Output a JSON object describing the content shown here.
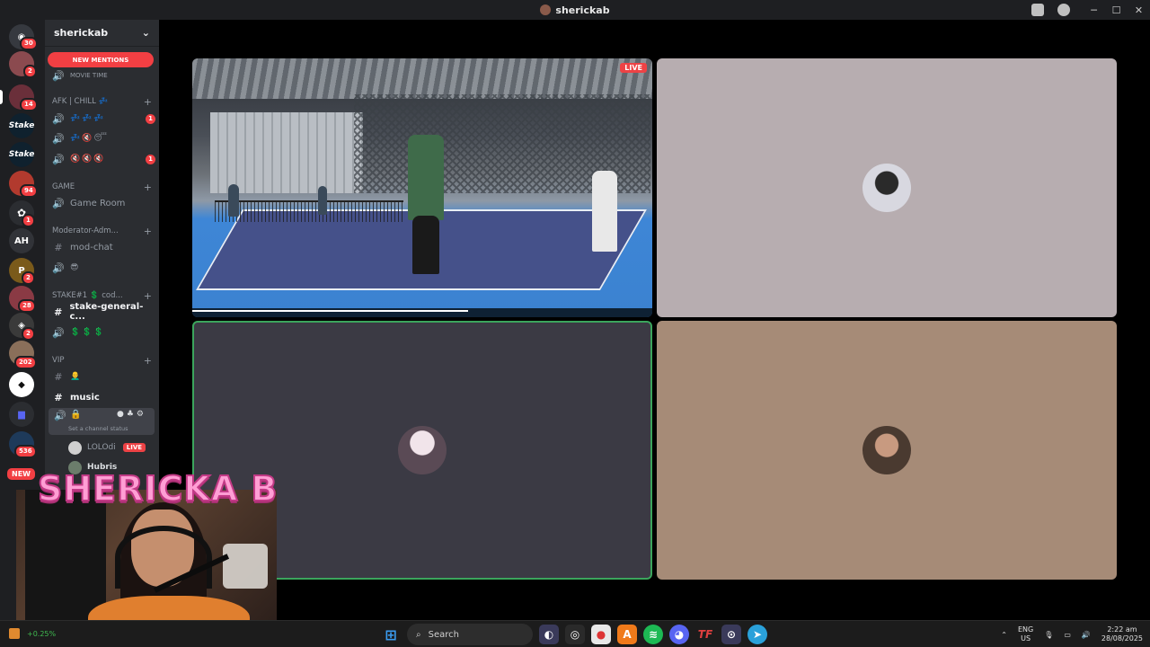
{
  "window": {
    "title": "sherickab"
  },
  "sidebar": {
    "server_name": "sherickab",
    "new_mentions": "NEW MENTIONS",
    "movie_time": "MOVIE TIME",
    "categories": {
      "afk": "AFK | CHILL 💤",
      "game": "GAME",
      "moderator": "Moderator-Adm...",
      "stake": "STAKE#1 💲 cod...",
      "vip": "VIP"
    },
    "channels": {
      "afk_1": "💤💤💤",
      "afk_2": "💤🔇😴",
      "afk_3": "🔇🔇🔇",
      "afk_1_badge": "1",
      "afk_3_badge": "1",
      "game_room": "Game Room",
      "mod_chat": "mod-chat",
      "mod_voice": "😎",
      "stake_general": "stake-general-c...",
      "stake_voice": "💲💲💲",
      "vip_text": "👨‍🦲",
      "music": "music",
      "set_status": "Set a channel status"
    },
    "voice_users": [
      {
        "name": "LOLOdi",
        "live": "LIVE"
      },
      {
        "name": "Hubris"
      }
    ]
  },
  "rail": {
    "badges": [
      "30",
      "2",
      "14",
      "94",
      "1",
      "2",
      "28",
      "2",
      "202",
      "536"
    ],
    "ah_label": "AH",
    "new_label": "NEW"
  },
  "stage": {
    "stream_live_badge": "LIVE"
  },
  "overlay": {
    "streamer_name": "SHERICKA B",
    "stat": "+0.25%"
  },
  "taskbar": {
    "search_placeholder": "Search",
    "lang_top": "ENG",
    "lang_bottom": "US",
    "time": "2:22 am",
    "date": "28/08/2025"
  },
  "colors": {
    "discord_bg": "#2b2d31",
    "rail_bg": "#1e1f22",
    "red": "#f23f43",
    "tile_gray": "#b7adb0",
    "tile_dark": "#3b3a44",
    "tile_tan": "#a68b77",
    "speaking_green": "#3ba55c"
  }
}
